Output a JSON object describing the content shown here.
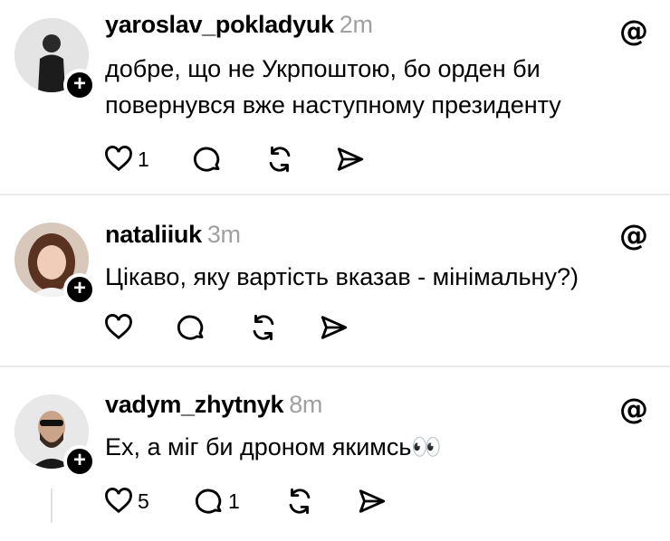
{
  "posts": [
    {
      "username": "yaroslav_pokladyuk",
      "time": "2m",
      "text": "добре, що не Укрпоштою, бо орден би повернувся вже наступному президенту",
      "likes": "1",
      "replies": ""
    },
    {
      "username": "nataliiuk",
      "time": "3m",
      "text": "Цікаво, яку вартість вказав - мінімальну?)",
      "likes": "",
      "replies": ""
    },
    {
      "username": "vadym_zhytnyk",
      "time": "8m",
      "text": "Ех, а міг би дроном якимсь👀",
      "likes": "5",
      "replies": "1"
    }
  ],
  "follow_badge": "+",
  "icons": {
    "like": "heart-icon",
    "reply": "comment-icon",
    "repost": "repost-icon",
    "share": "send-icon",
    "brand": "threads-logo-icon"
  }
}
